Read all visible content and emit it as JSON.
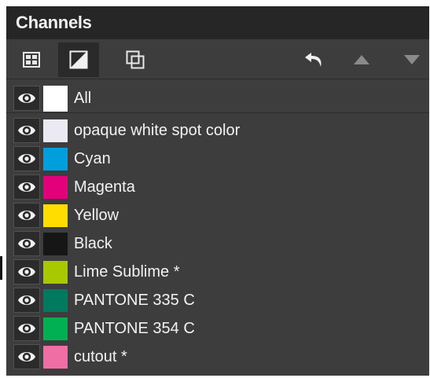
{
  "panel": {
    "title": "Channels"
  },
  "toolbar": {
    "tools": [
      {
        "icon": "grid-icon"
      },
      {
        "icon": "contrast-icon"
      },
      {
        "icon": "overlap-icon"
      },
      {
        "icon": "undo-icon"
      },
      {
        "icon": "arrow-up-icon"
      },
      {
        "icon": "arrow-down-icon"
      }
    ]
  },
  "channels": {
    "all": {
      "label": "All",
      "color": "#ffffff",
      "visible": true
    },
    "items": [
      {
        "label": "opaque white spot color",
        "color": "#ebe9f2",
        "visible": true
      },
      {
        "label": "Cyan",
        "color": "#009fdc",
        "visible": true
      },
      {
        "label": "Magenta",
        "color": "#e2007b",
        "visible": true
      },
      {
        "label": "Yellow",
        "color": "#ffdd00",
        "visible": true
      },
      {
        "label": "Black",
        "color": "#161616",
        "visible": true
      },
      {
        "label": "Lime Sublime *",
        "color": "#a8c800",
        "visible": true
      },
      {
        "label": "PANTONE 335 C",
        "color": "#007a5e",
        "visible": true
      },
      {
        "label": "PANTONE 354 C",
        "color": "#00b052",
        "visible": true
      },
      {
        "label": "cutout *",
        "color": "#ef6ea4",
        "visible": true
      }
    ]
  }
}
